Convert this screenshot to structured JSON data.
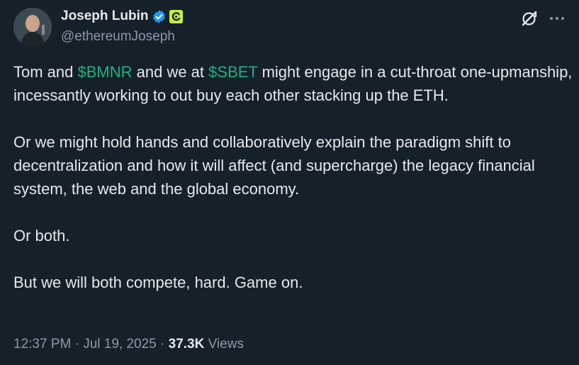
{
  "author": {
    "display_name": "Joseph Lubin",
    "handle": "@ethereumJoseph",
    "verified_icon": "verified-badge-icon",
    "affiliate_icon": "affiliate-badge-icon"
  },
  "actions": {
    "grok_icon": "grok-icon",
    "more_icon": "more-options-icon"
  },
  "tweet": {
    "p1_a": "Tom and ",
    "p1_cashtag1": "$BMNR",
    "p1_b": " and we at ",
    "p1_cashtag2": "$SBET",
    "p1_c": " might engage in a cut-throat one-upmanship, incessantly working to out buy each other stacking up the ETH.",
    "p2": "Or we might hold hands and collaboratively explain the paradigm shift to decentralization and how it will affect (and supercharge) the legacy financial system, the web and the global economy.",
    "p3": "Or both.",
    "p4": "But we will both compete, hard.  Game on."
  },
  "meta": {
    "time": "12:37 PM",
    "separator": " · ",
    "date": "Jul 19, 2025",
    "views_count": "37.3K",
    "views_label": " Views"
  },
  "colors": {
    "background": "#15202b",
    "text_primary": "#e7e9ea",
    "text_secondary": "#8b98a5",
    "cashtag": "#21b27f",
    "verified_blue": "#1d9bf0",
    "affiliate_green": "#c4f03d"
  }
}
